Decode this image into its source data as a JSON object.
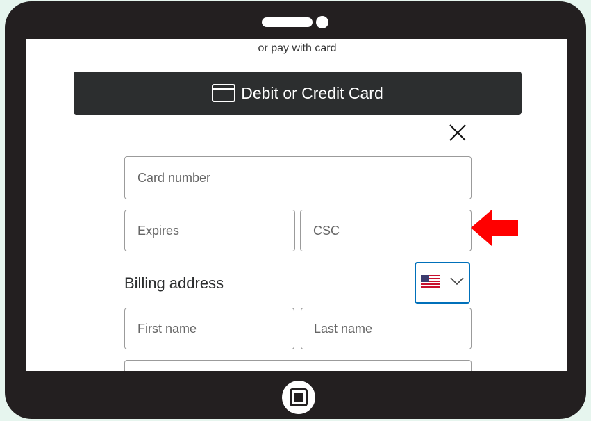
{
  "divider": {
    "label": "or pay with card"
  },
  "card_button": {
    "label": "Debit or Credit Card",
    "icon": "credit-card-icon"
  },
  "close_icon": "close-icon",
  "fields": {
    "card_number": {
      "placeholder": "Card number"
    },
    "expires": {
      "placeholder": "Expires"
    },
    "csc": {
      "placeholder": "CSC"
    },
    "first_name": {
      "placeholder": "First name"
    },
    "last_name": {
      "placeholder": "Last name"
    }
  },
  "billing": {
    "title": "Billing address"
  },
  "country_select": {
    "flag": "us-flag-icon",
    "chevron": "chevron-down-icon"
  },
  "colors": {
    "button_bg": "#2c2e2f",
    "focus_border": "#0070ba",
    "arrow": "#ff0000",
    "tablet_frame": "#231f20"
  }
}
